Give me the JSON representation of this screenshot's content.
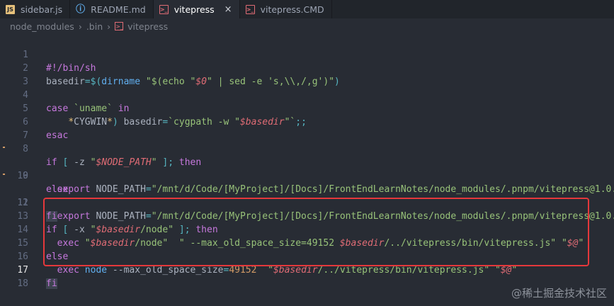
{
  "tabs": [
    {
      "label": "sidebar.js",
      "icon": "javascript-file-icon",
      "active": false
    },
    {
      "label": "README.md",
      "icon": "info-icon",
      "active": false
    },
    {
      "label": "vitepress",
      "icon": "terminal-file-icon",
      "active": true
    },
    {
      "label": "vitepress.CMD",
      "icon": "terminal-file-icon",
      "active": false
    }
  ],
  "active_tab_close": "×",
  "breadcrumb": [
    "node_modules",
    ".bin",
    "vitepress"
  ],
  "lines": [
    {
      "n": "1",
      "text": "#!/bin/sh"
    },
    {
      "n": "2",
      "text": "basedir=$(dirname \"$(echo \"$0\" | sed -e 's,\\\\,/,g')\")"
    },
    {
      "n": "3",
      "text": ""
    },
    {
      "n": "4",
      "text": "case `uname` in"
    },
    {
      "n": "5",
      "text": "    *CYGWIN*) basedir=`cygpath -w \"$basedir\"`;;"
    },
    {
      "n": "6",
      "text": "esac"
    },
    {
      "n": "7",
      "text": ""
    },
    {
      "n": "8",
      "text": "if [ -z \"$NODE_PATH\" ]; then"
    },
    {
      "n": "9",
      "text": "  export NODE_PATH=\"/mnt/d/Code/[MyProject]/[Docs]/FrontEndLearnNotes/node_modules/.pnpm/vitepress@1.0.1"
    },
    {
      "n": "10",
      "text": "else"
    },
    {
      "n": "11",
      "text": "  export NODE_PATH=\"/mnt/d/Code/[MyProject]/[Docs]/FrontEndLearnNotes/node_modules/.pnpm/vitepress@1.0.1"
    },
    {
      "n": "12",
      "text": "fi"
    },
    {
      "n": "13",
      "text": "if [ -x \"$basedir/node\" ]; then"
    },
    {
      "n": "14",
      "text": "  exec \"$basedir/node\"  \" --max_old_space_size=49152 $basedir/../vitepress/bin/vitepress.js\" \"$@\""
    },
    {
      "n": "15",
      "text": "else"
    },
    {
      "n": "16",
      "text": "  exec node --max_old_space_size=49152  \"$basedir/../vitepress/bin/vitepress.js\" \"$@\""
    },
    {
      "n": "17",
      "text": "fi"
    },
    {
      "n": "18",
      "text": ""
    }
  ],
  "current_line": "17",
  "colors": {
    "background": "#282c34",
    "keyword": "#c678dd",
    "string": "#98c379",
    "variable": "#e06c75",
    "highlight_box": "#e5383b"
  },
  "watermark": "@稀土掘金技术社区"
}
